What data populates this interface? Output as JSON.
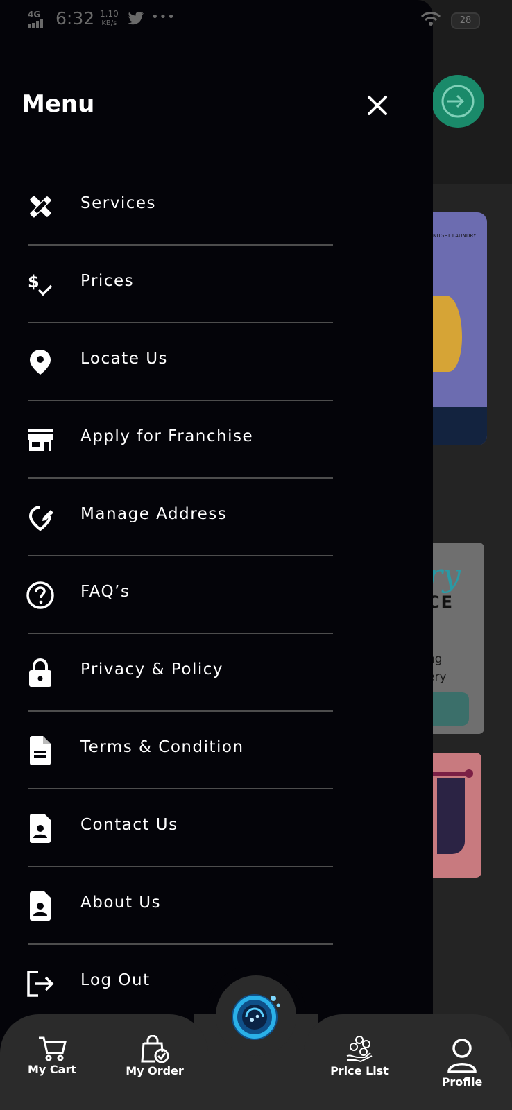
{
  "status_bar": {
    "network": "4G",
    "time": "6:32",
    "speed_value": "1.10",
    "speed_unit": "KB/s",
    "more": "•••",
    "battery": "28"
  },
  "background": {
    "card1_brand": "NUGET LAUNDRY",
    "card2_script": "ry",
    "card2_heading": "CE",
    "card2_line1": "ng",
    "card2_line2": "ery"
  },
  "drawer": {
    "title": "Menu",
    "items": [
      {
        "label": "Services",
        "icon": "tools-icon"
      },
      {
        "label": "Prices",
        "icon": "price-check-icon"
      },
      {
        "label": "Locate Us",
        "icon": "location-pin-icon"
      },
      {
        "label": "Apply for Franchise",
        "icon": "storefront-icon"
      },
      {
        "label": "Manage Address",
        "icon": "edit-location-icon"
      },
      {
        "label": "FAQ’s",
        "icon": "help-circle-icon"
      },
      {
        "label": "Privacy & Policy",
        "icon": "lock-icon"
      },
      {
        "label": "Terms & Condition",
        "icon": "document-icon"
      },
      {
        "label": "Contact Us",
        "icon": "contact-card-icon"
      },
      {
        "label": "About Us",
        "icon": "contact-card-icon"
      },
      {
        "label": "Log Out",
        "icon": "logout-icon"
      }
    ]
  },
  "bottom_nav": {
    "cart": "My Cart",
    "order": "My Order",
    "price_list": "Price List",
    "profile": "Profile"
  },
  "colors": {
    "drawer_bg": "#040409",
    "login_button": "#1a8a6a",
    "bottom_bar": "#2b2b2b",
    "fab_accent": "#1fa3e0"
  }
}
